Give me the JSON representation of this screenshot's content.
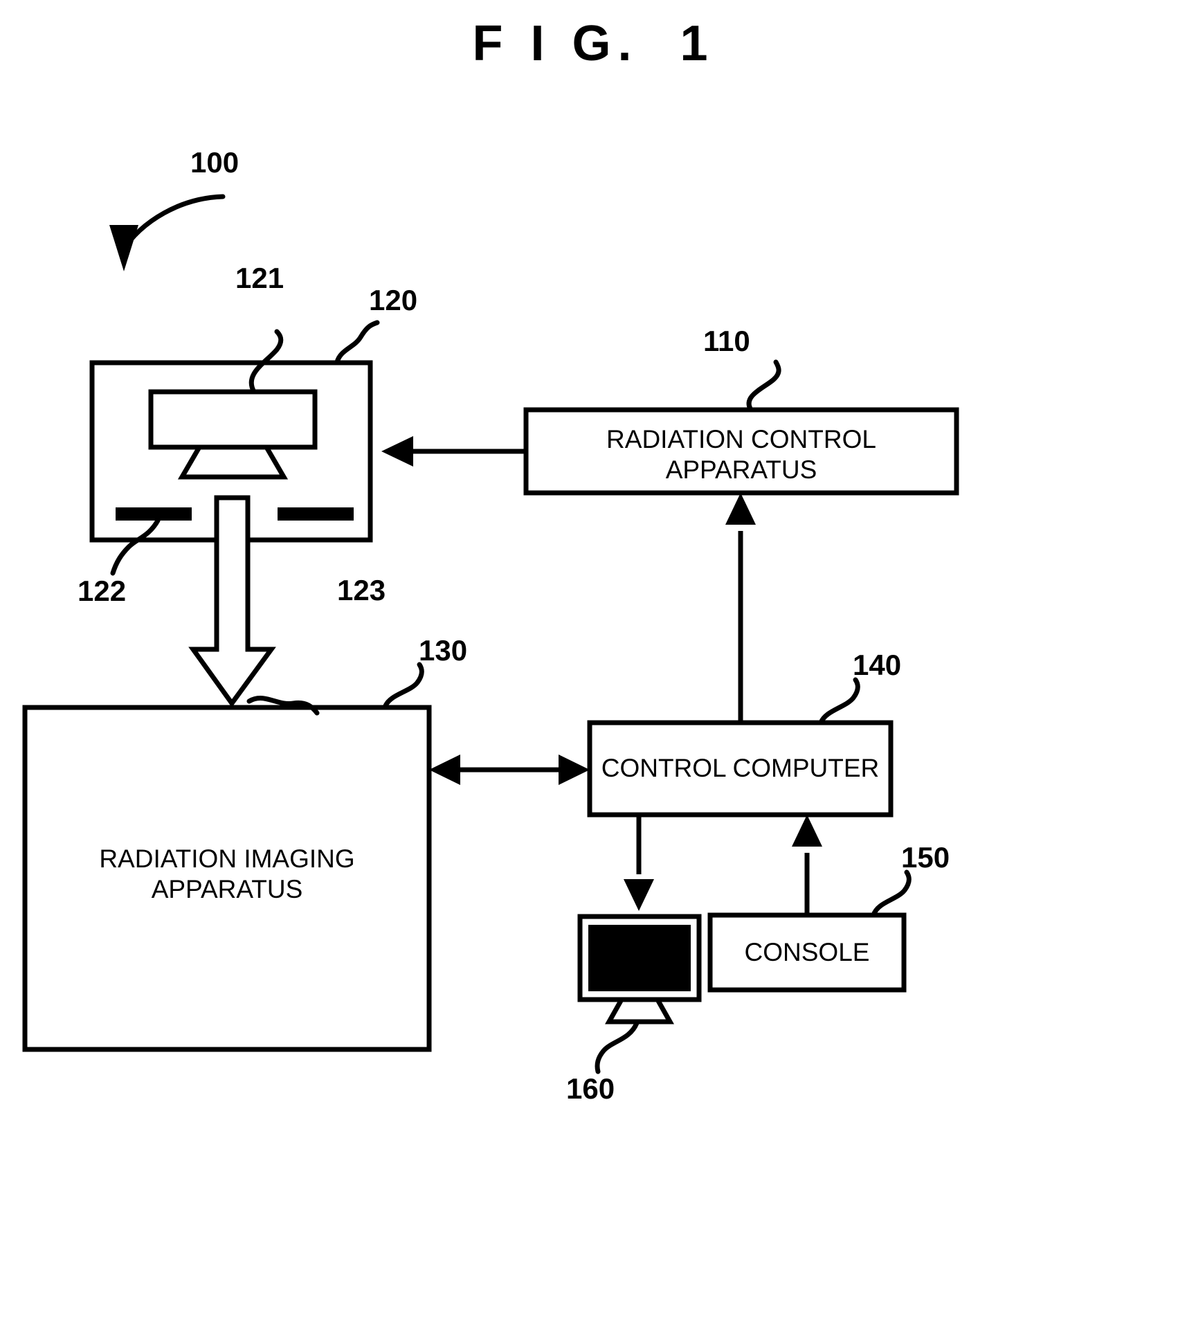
{
  "figure": {
    "title": "F I G.  1",
    "background_color": "#ffffff",
    "line_color": "#000000"
  },
  "reference_numerals": [
    {
      "id": "100",
      "label": "100",
      "points_to": "radiation-imaging-system"
    },
    {
      "id": "110",
      "label": "110",
      "points_to": "radiation-control-apparatus"
    },
    {
      "id": "120",
      "label": "120",
      "points_to": "radiation-source-unit"
    },
    {
      "id": "121",
      "label": "121",
      "points_to": "radiation-tube"
    },
    {
      "id": "122",
      "label": "122",
      "points_to": "collimator-blade"
    },
    {
      "id": "123",
      "label": "123",
      "points_to": "radiation-beam"
    },
    {
      "id": "130",
      "label": "130",
      "points_to": "radiation-imaging-apparatus"
    },
    {
      "id": "140",
      "label": "140",
      "points_to": "control-computer"
    },
    {
      "id": "150",
      "label": "150",
      "points_to": "console"
    },
    {
      "id": "160",
      "label": "160",
      "points_to": "monitor"
    }
  ],
  "blocks": {
    "radiation_control_apparatus": {
      "ref": "110",
      "label": "RADIATION CONTROL\nAPPARATUS"
    },
    "radiation_source_unit": {
      "ref": "120",
      "label": ""
    },
    "radiation_tube": {
      "ref": "121",
      "label": ""
    },
    "collimator_blade": {
      "ref": "122",
      "label": ""
    },
    "radiation_beam": {
      "ref": "123",
      "label": ""
    },
    "radiation_imaging_apparatus": {
      "ref": "130",
      "label": "RADIATION IMAGING\nAPPARATUS"
    },
    "control_computer": {
      "ref": "140",
      "label": "CONTROL COMPUTER"
    },
    "console": {
      "ref": "150",
      "label": "CONSOLE"
    },
    "monitor": {
      "ref": "160",
      "label": ""
    }
  },
  "connections": [
    {
      "from": "radiation-control-apparatus",
      "to": "radiation-source-unit",
      "arrow": "single-left"
    },
    {
      "from": "control-computer",
      "to": "radiation-control-apparatus",
      "arrow": "single-up"
    },
    {
      "from": "radiation-imaging-apparatus",
      "to": "control-computer",
      "arrow": "double-horizontal"
    },
    {
      "from": "control-computer",
      "to": "monitor",
      "arrow": "single-down"
    },
    {
      "from": "console",
      "to": "control-computer",
      "arrow": "single-up"
    },
    {
      "from": "radiation-source-unit",
      "to": "radiation-imaging-apparatus",
      "arrow": "hollow-down-beam"
    }
  ]
}
